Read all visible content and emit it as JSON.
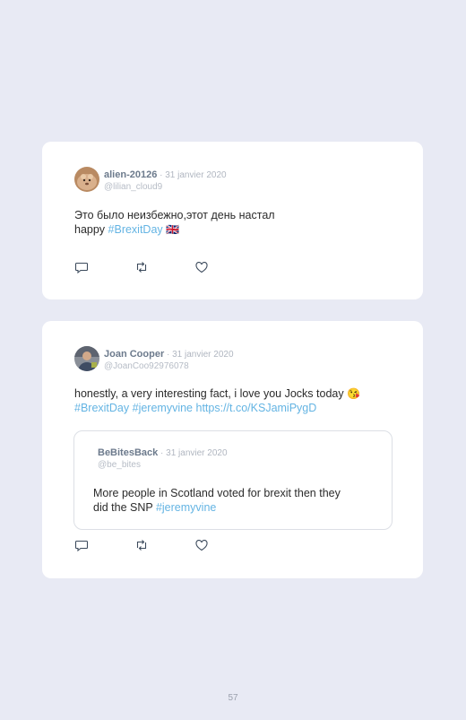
{
  "tweets": [
    {
      "name": "alien-20126",
      "sep": " · ",
      "date": "31 janvier 2020",
      "handle": "@lilian_cloud9",
      "line1": "Это было неизбежно,этот день настал",
      "line2_prefix": "happy ",
      "line2_hashtag": "#BrexitDay",
      "line2_emoji": "🇬🇧"
    },
    {
      "name": "Joan Cooper",
      "sep": " · ",
      "date": "31 janvier 2020",
      "handle": "@JoanCoo92976078",
      "line1": "honestly, a very interesting fact, i love you Jocks today",
      "line1_emoji": "😘",
      "line2_hashtag1": "#BrexitDay",
      "line2_hashtag2": "#jeremyvine",
      "line2_url": "https://t.co/KSJamiPygD",
      "quote": {
        "name": "BeBitesBack",
        "sep": " · ",
        "date": "31 janvier 2020",
        "handle": "@be_bites",
        "line1": "More people in Scotland voted for brexit then they",
        "line2_prefix": "did the SNP ",
        "line2_hashtag": "#jeremyvine"
      }
    }
  ],
  "icons": [
    "reply-icon",
    "retweet-icon",
    "like-icon"
  ],
  "colors": {
    "background": "#e8eaf4",
    "card": "#ffffff",
    "link": "#64b4e3",
    "name": "#6c7a8c"
  },
  "page_number": "57"
}
